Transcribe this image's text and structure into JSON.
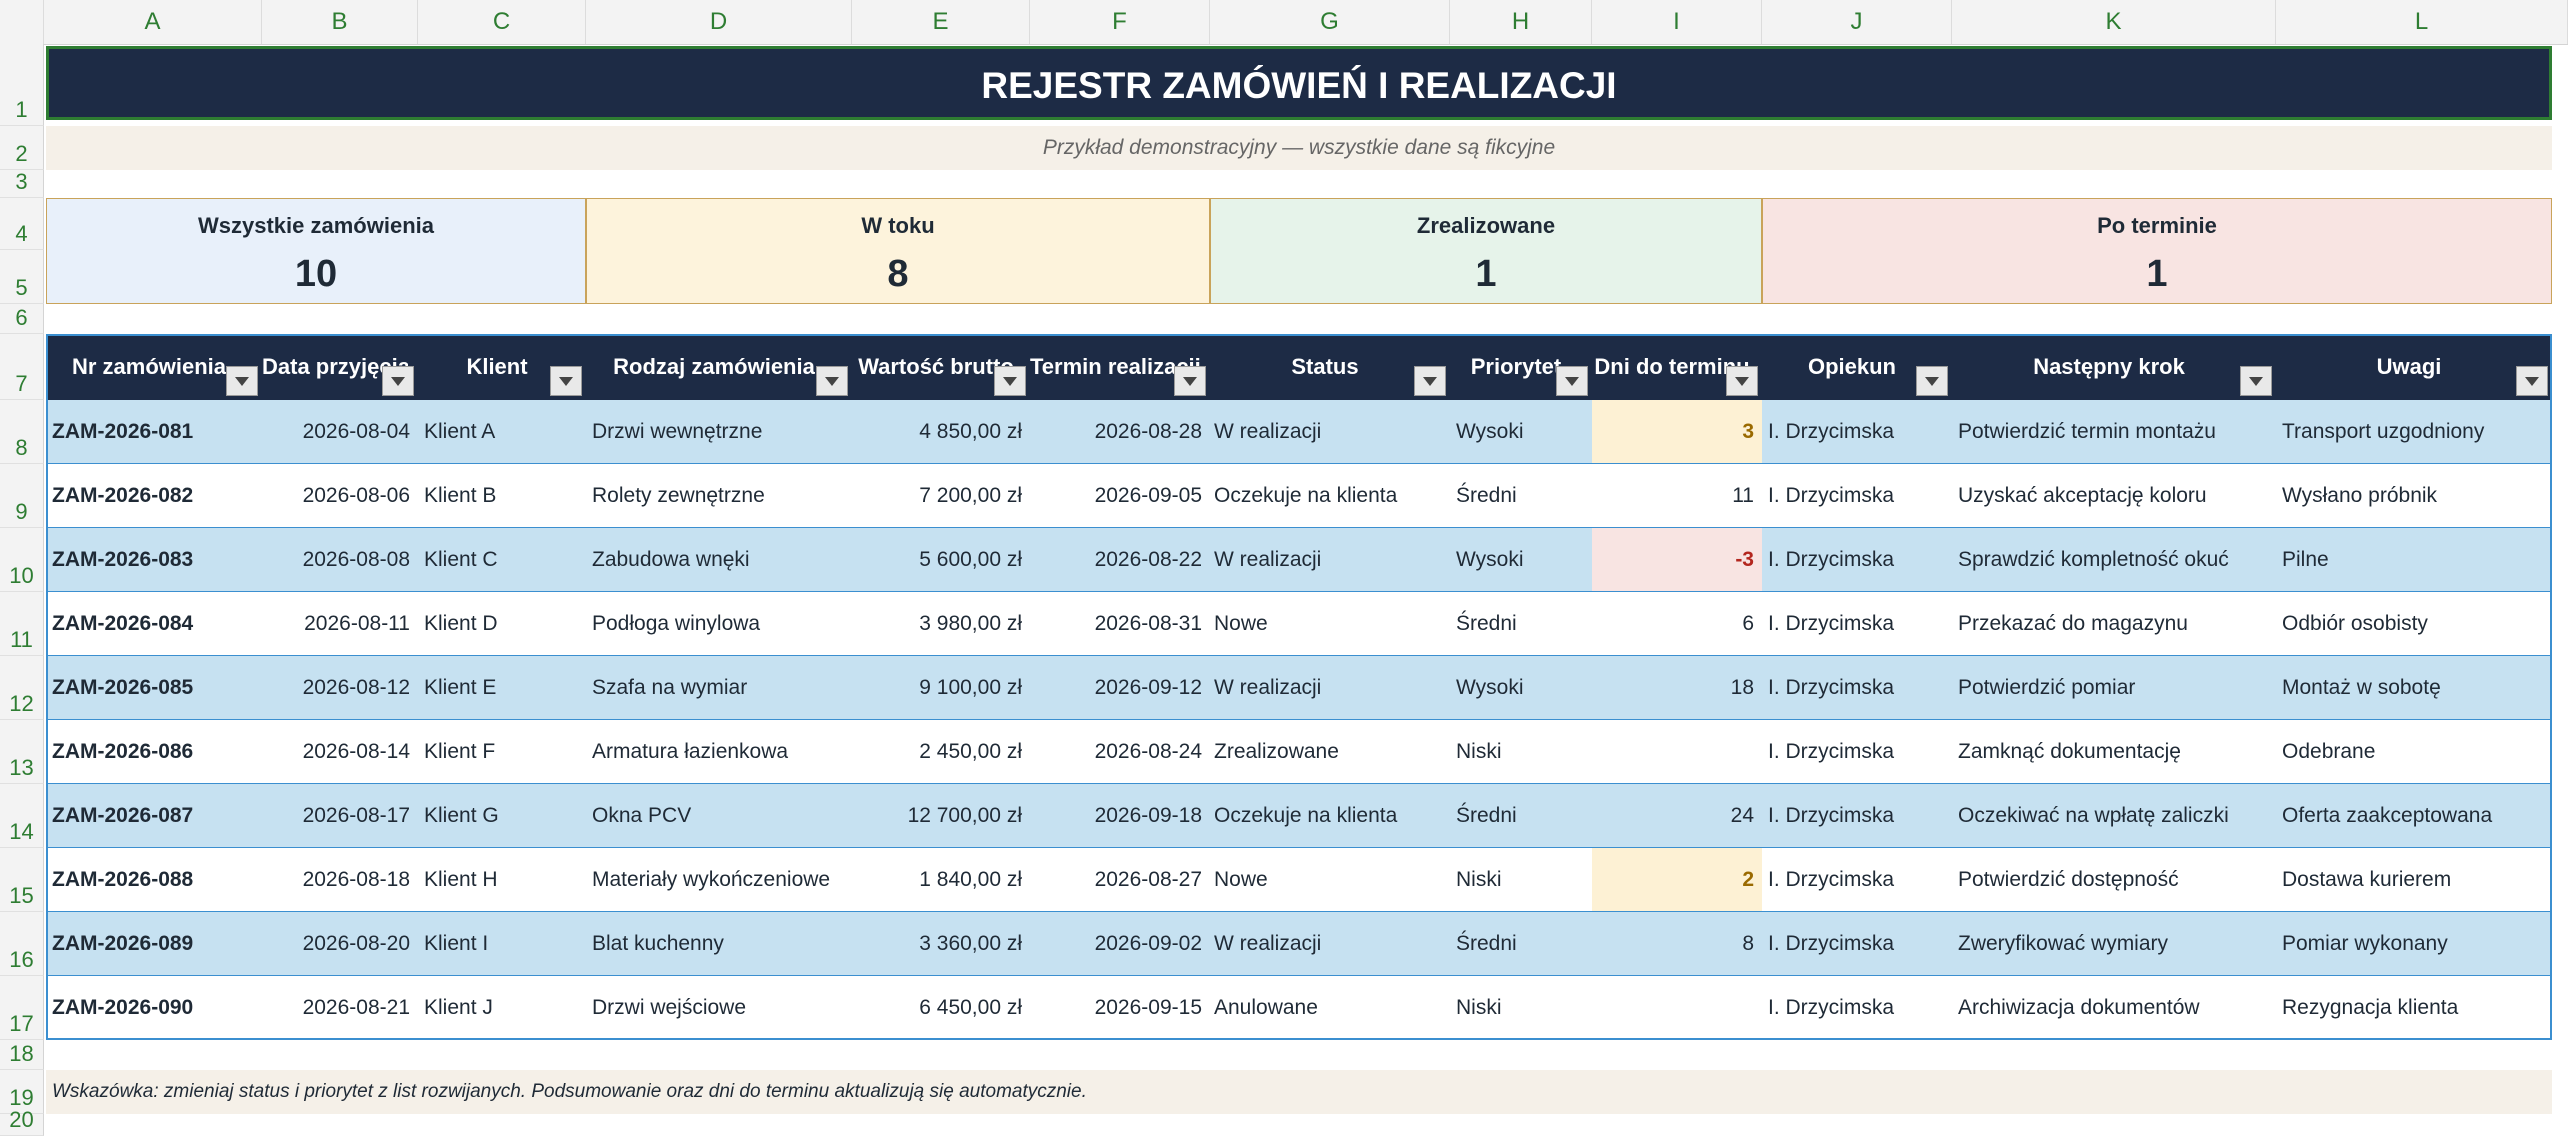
{
  "columns": [
    "A",
    "B",
    "C",
    "D",
    "E",
    "F",
    "G",
    "H",
    "I",
    "J",
    "K",
    "L"
  ],
  "rows": [
    "1",
    "2",
    "3",
    "4",
    "5",
    "6",
    "7",
    "8",
    "9",
    "10",
    "11",
    "12",
    "13",
    "14",
    "15",
    "16",
    "17",
    "18",
    "19",
    "20"
  ],
  "title": "REJESTR ZAMÓWIEŃ I REALIZACJI",
  "subtitle": "Przykład demonstracyjny — wszystkie dane są fikcyjne",
  "kpis": [
    {
      "label": "Wszystkie zamówienia",
      "value": "10",
      "bg": "#e8f0fa"
    },
    {
      "label": "W toku",
      "value": "8",
      "bg": "#fdf3dc"
    },
    {
      "label": "Zrealizowane",
      "value": "1",
      "bg": "#e6f3ea"
    },
    {
      "label": "Po terminie",
      "value": "1",
      "bg": "#f8e4e2"
    }
  ],
  "headers": [
    "Nr zamówienia",
    "Data przyjęcia",
    "Klient",
    "Rodzaj zamówienia",
    "Wartość brutto",
    "Termin realizacji",
    "Status",
    "Priorytet",
    "Dni do terminu",
    "Opiekun",
    "Następny krok",
    "Uwagi"
  ],
  "orders": [
    [
      "ZAM-2026-081",
      "2026-08-04",
      "Klient A",
      "Drzwi wewnętrzne",
      "4 850,00 zł",
      "2026-08-28",
      "W realizacji",
      "Wysoki",
      "3",
      "I. Drzycimska",
      "Potwierdzić termin montażu",
      "Transport uzgodniony"
    ],
    [
      "ZAM-2026-082",
      "2026-08-06",
      "Klient B",
      "Rolety zewnętrzne",
      "7 200,00 zł",
      "2026-09-05",
      "Oczekuje na klienta",
      "Średni",
      "11",
      "I. Drzycimska",
      "Uzyskać akceptację koloru",
      "Wysłano próbnik"
    ],
    [
      "ZAM-2026-083",
      "2026-08-08",
      "Klient C",
      "Zabudowa wnęki",
      "5 600,00 zł",
      "2026-08-22",
      "W realizacji",
      "Wysoki",
      "-3",
      "I. Drzycimska",
      "Sprawdzić kompletność okuć",
      "Pilne"
    ],
    [
      "ZAM-2026-084",
      "2026-08-11",
      "Klient D",
      "Podłoga winylowa",
      "3 980,00 zł",
      "2026-08-31",
      "Nowe",
      "Średni",
      "6",
      "I. Drzycimska",
      "Przekazać do magazynu",
      "Odbiór osobisty"
    ],
    [
      "ZAM-2026-085",
      "2026-08-12",
      "Klient E",
      "Szafa na wymiar",
      "9 100,00 zł",
      "2026-09-12",
      "W realizacji",
      "Wysoki",
      "18",
      "I. Drzycimska",
      "Potwierdzić pomiar",
      "Montaż w sobotę"
    ],
    [
      "ZAM-2026-086",
      "2026-08-14",
      "Klient F",
      "Armatura łazienkowa",
      "2 450,00 zł",
      "2026-08-24",
      "Zrealizowane",
      "Niski",
      "",
      "I. Drzycimska",
      "Zamknąć dokumentację",
      "Odebrane"
    ],
    [
      "ZAM-2026-087",
      "2026-08-17",
      "Klient G",
      "Okna PCV",
      "12 700,00 zł",
      "2026-09-18",
      "Oczekuje na klienta",
      "Średni",
      "24",
      "I. Drzycimska",
      "Oczekiwać na wpłatę zaliczki",
      "Oferta zaakceptowana"
    ],
    [
      "ZAM-2026-088",
      "2026-08-18",
      "Klient H",
      "Materiały wykończeniowe",
      "1 840,00 zł",
      "2026-08-27",
      "Nowe",
      "Niski",
      "2",
      "I. Drzycimska",
      "Potwierdzić dostępność",
      "Dostawa kurierem"
    ],
    [
      "ZAM-2026-089",
      "2026-08-20",
      "Klient I",
      "Blat kuchenny",
      "3 360,00 zł",
      "2026-09-02",
      "W realizacji",
      "Średni",
      "8",
      "I. Drzycimska",
      "Zweryfikować wymiary",
      "Pomiar wykonany"
    ],
    [
      "ZAM-2026-090",
      "2026-08-21",
      "Klient J",
      "Drzwi wejściowe",
      "6 450,00 zł",
      "2026-09-15",
      "Anulowane",
      "Niski",
      "",
      "I. Drzycimska",
      "Archiwizacja dokumentów",
      "Rezygnacja klienta"
    ]
  ],
  "days_highlight": {
    "warning_bg": "#fdf1d4",
    "warning_fg": "#9a6a00",
    "overdue_bg": "#f8e4e2",
    "overdue_fg": "#b3261e"
  },
  "hint": "Wskazówka: zmieniaj status i priorytet z list rozwijanych. Podsumowanie oraz dni do terminu aktualizują się automatycznie."
}
